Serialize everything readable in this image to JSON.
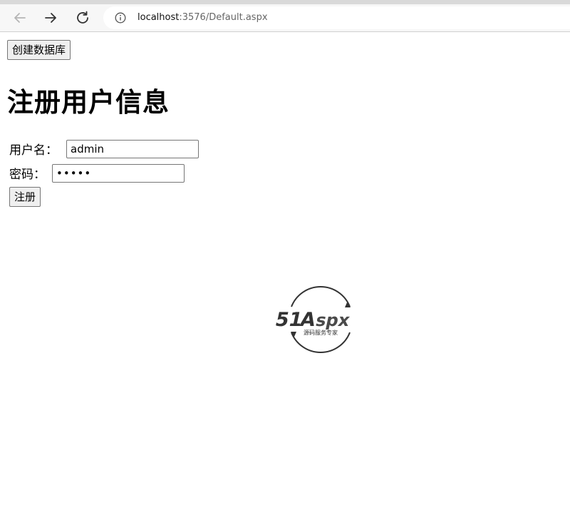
{
  "browser": {
    "url_host": "localhost",
    "url_rest": ":3576/Default.aspx"
  },
  "page": {
    "create_db_label": "创建数据库",
    "title": "注册用户信息",
    "username_label": "用户名：",
    "username_value": "admin",
    "password_label": "密码：",
    "password_value": "•••••",
    "register_label": "注册"
  },
  "logo": {
    "brand": "51Aspx",
    "tagline": "源码服务专家"
  }
}
